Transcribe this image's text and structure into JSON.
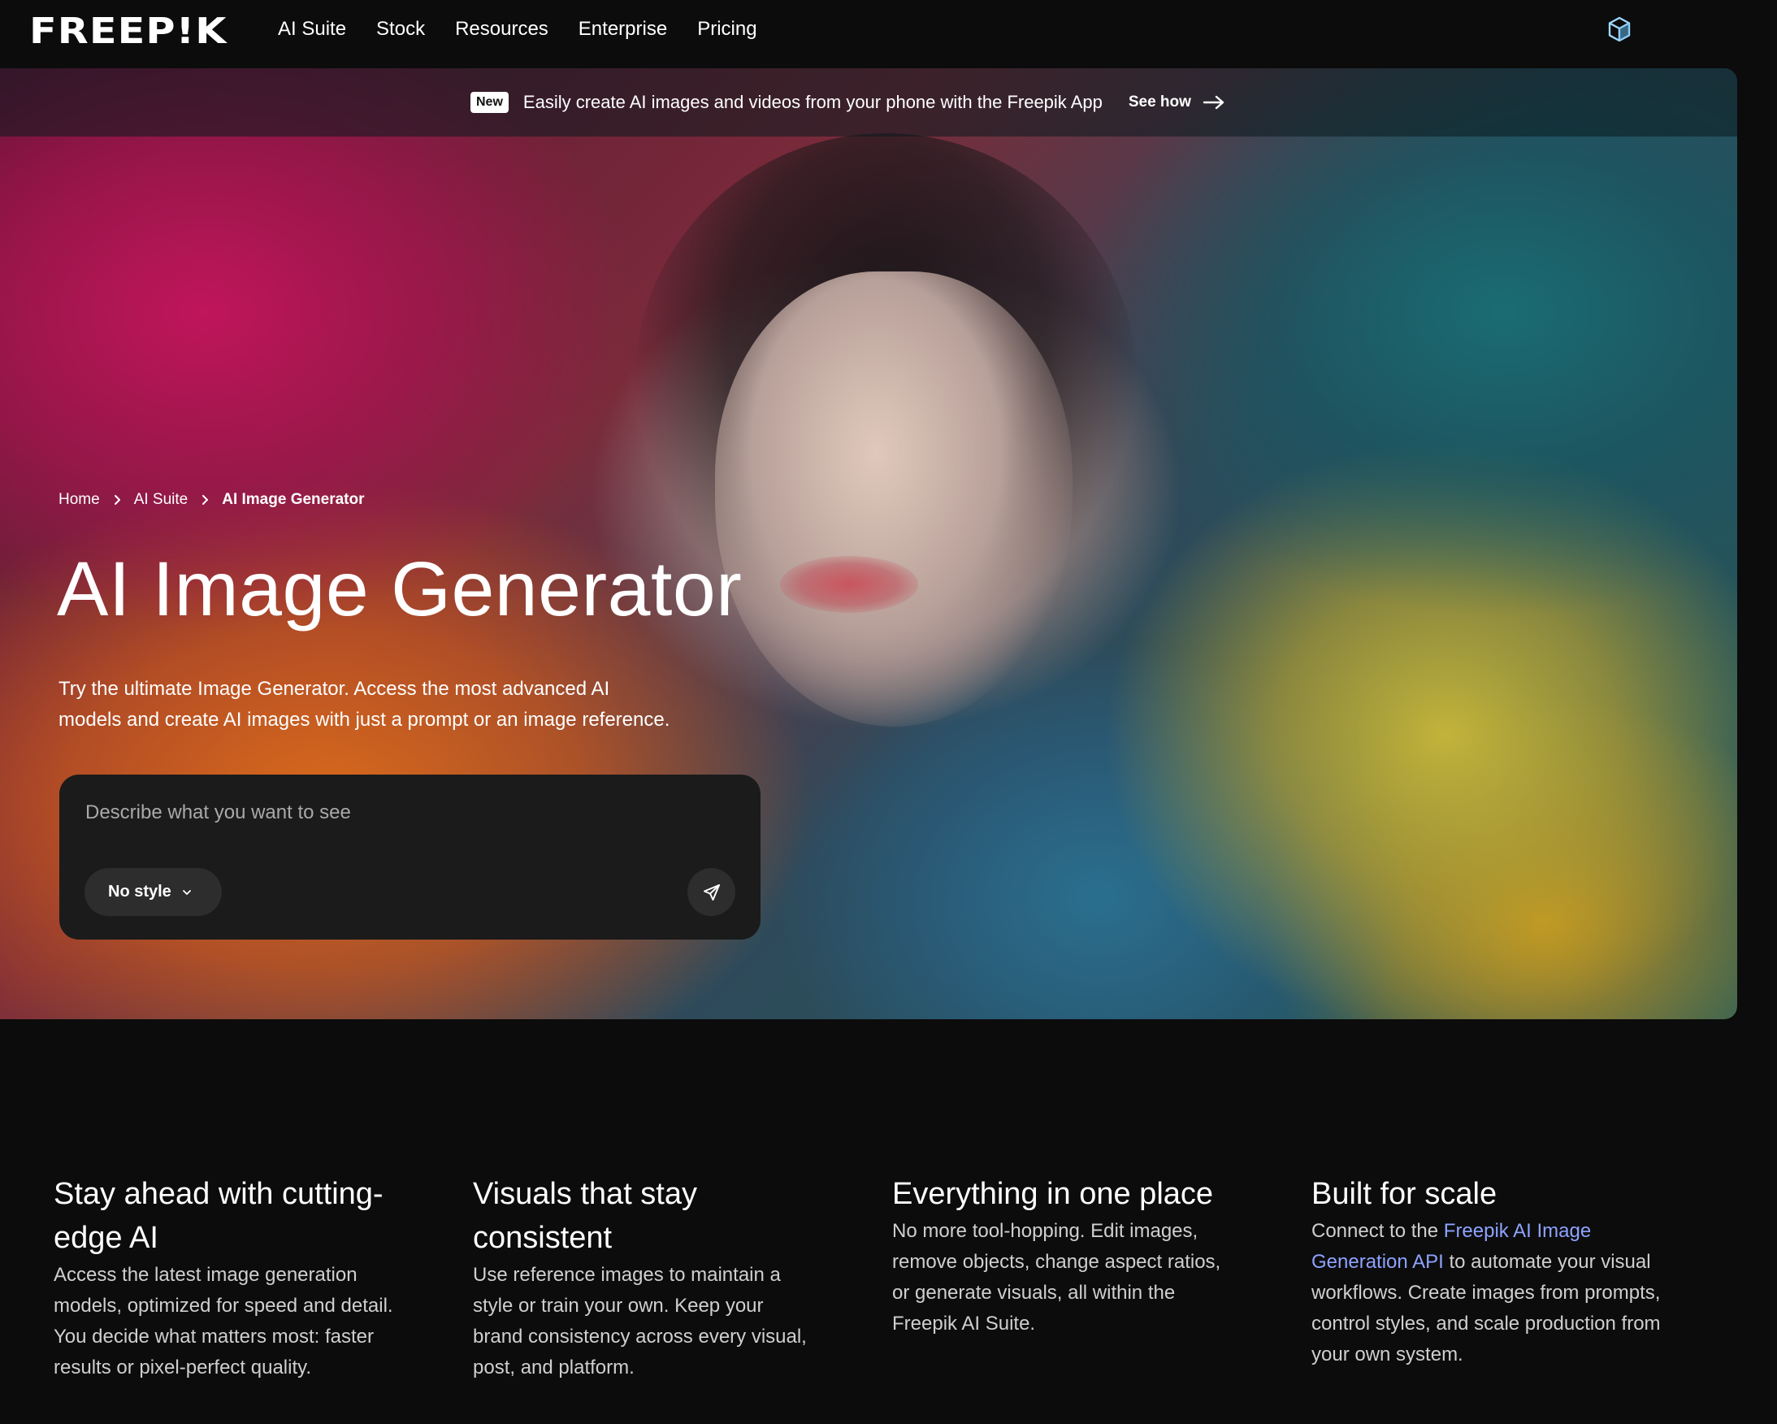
{
  "brand": {
    "logo_text": "FREEP!K"
  },
  "nav": {
    "items": [
      {
        "label": "AI Suite"
      },
      {
        "label": "Stock"
      },
      {
        "label": "Resources"
      },
      {
        "label": "Enterprise"
      },
      {
        "label": "Pricing"
      }
    ],
    "right_icon": "cube-icon"
  },
  "banner": {
    "badge": "New",
    "text": "Easily create AI images and videos from your phone with the Freepik App",
    "cta": "See how"
  },
  "breadcrumb": {
    "items": [
      "Home",
      "AI Suite"
    ],
    "current": "AI Image Generator"
  },
  "hero": {
    "title": "AI Image Generator",
    "subtitle_line1": "Try the ultimate Image Generator. Access the most advanced AI",
    "subtitle_line2": "models and create AI images with just a prompt or an image reference."
  },
  "prompt": {
    "placeholder": "Describe what you want to see",
    "value": "",
    "style_label": "No style"
  },
  "features": [
    {
      "title": "Stay ahead with cutting-edge AI",
      "body": "Access the latest image generation models, optimized for speed and detail. You decide what matters most: faster results or pixel-perfect quality."
    },
    {
      "title": "Visuals that stay consistent",
      "body": "Use reference images to maintain a style or train your own. Keep your brand consistency across every visual, post, and platform."
    },
    {
      "title": "Everything in one place",
      "body": "No more tool-hopping. Edit images, remove objects, change aspect ratios, or generate visuals, all within the Freepik AI Suite."
    },
    {
      "title": "Built for scale",
      "body_prefix": "Connect to the ",
      "link": "Freepik AI Image Generation API",
      "body_suffix": " to automate your visual workflows. Create images from prompts, control styles, and scale production from your own system."
    }
  ],
  "colors": {
    "background": "#0c0c0c",
    "prompt_box": "#1b1b1b",
    "pill": "#2d2d2d",
    "link": "#8ea3ff"
  }
}
